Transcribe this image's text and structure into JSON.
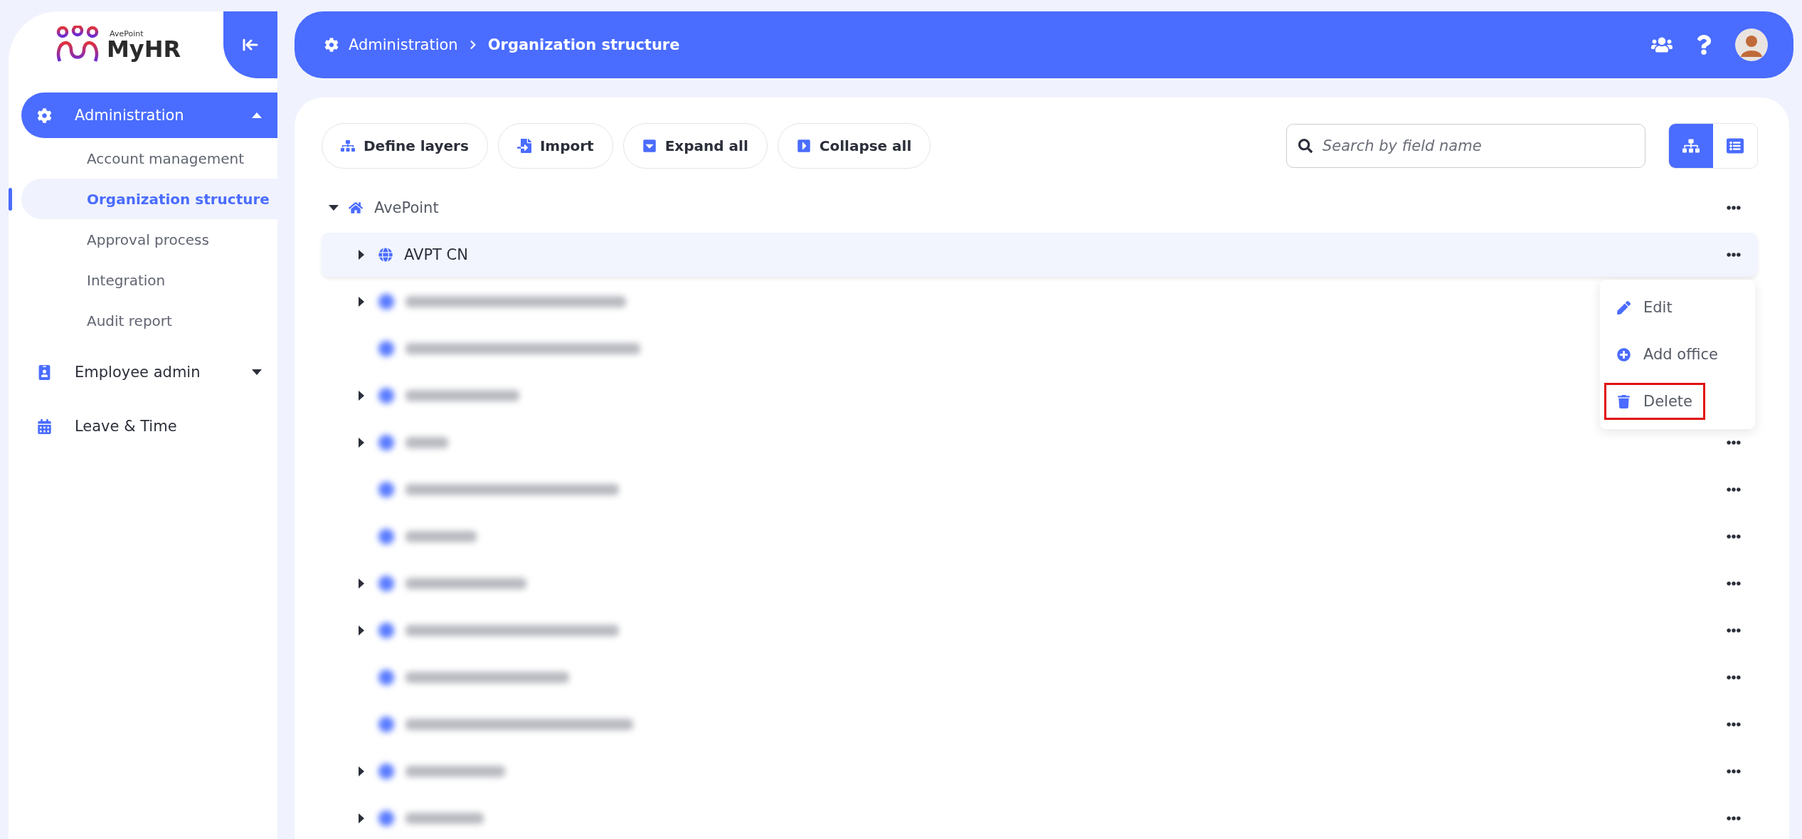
{
  "logo": {
    "brand": "AvePoint",
    "name": "MyHR"
  },
  "sidebar": {
    "items": [
      {
        "label": "Administration",
        "kind": "group",
        "active": true,
        "expanded": true,
        "children": [
          {
            "label": "Account management",
            "selected": false
          },
          {
            "label": "Organization structure",
            "selected": true
          },
          {
            "label": "Approval process",
            "selected": false
          },
          {
            "label": "Integration",
            "selected": false
          },
          {
            "label": "Audit report",
            "selected": false
          }
        ]
      },
      {
        "label": "Employee admin",
        "kind": "group",
        "active": false,
        "expanded": false
      },
      {
        "label": "Leave & Time",
        "kind": "link",
        "active": false
      }
    ]
  },
  "header": {
    "breadcrumb": [
      "Administration",
      "Organization structure"
    ]
  },
  "toolbar": {
    "buttons": [
      "Define layers",
      "Import",
      "Expand all",
      "Collapse all"
    ],
    "search": {
      "placeholder": "Search by field name"
    },
    "views": [
      {
        "kind": "tree",
        "selected": true
      },
      {
        "kind": "list",
        "selected": false
      }
    ]
  },
  "tree": {
    "root": {
      "label": "AvePoint",
      "expanded": true,
      "selected": false,
      "children": [
        {
          "label": "AVPT CN",
          "blurred": false,
          "expandable": true,
          "selected": true,
          "menu": [
            {
              "label": "Edit",
              "outlined": false
            },
            {
              "label": "Add office",
              "outlined": false
            },
            {
              "label": "Delete",
              "outlined": true
            }
          ]
        },
        {
          "blurred": true,
          "expandable": true,
          "selected": false
        },
        {
          "blurred": true,
          "expandable": false,
          "selected": false
        },
        {
          "blurred": true,
          "expandable": true,
          "selected": false
        },
        {
          "blurred": true,
          "expandable": true,
          "selected": false
        },
        {
          "blurred": true,
          "expandable": false,
          "selected": false
        },
        {
          "blurred": true,
          "expandable": false,
          "selected": false
        },
        {
          "blurred": true,
          "expandable": true,
          "selected": false
        },
        {
          "blurred": true,
          "expandable": true,
          "selected": false
        },
        {
          "blurred": true,
          "expandable": false,
          "selected": false
        },
        {
          "blurred": true,
          "expandable": false,
          "selected": false
        },
        {
          "blurred": true,
          "expandable": true,
          "selected": false
        },
        {
          "blurred": true,
          "expandable": true,
          "selected": false
        }
      ]
    }
  }
}
